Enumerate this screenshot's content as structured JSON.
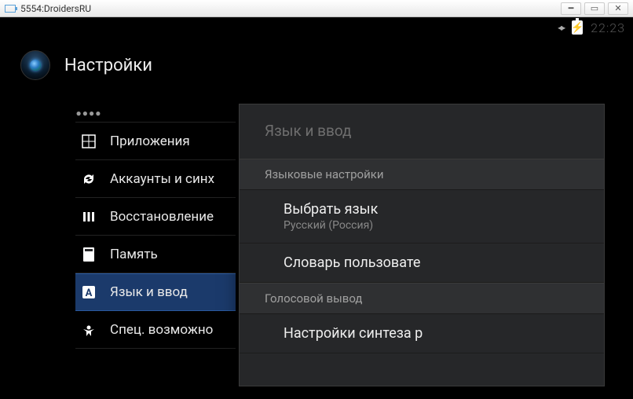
{
  "window": {
    "title": "5554:DroidersRU"
  },
  "status": {
    "time": "22:23"
  },
  "header": {
    "title": "Настройки"
  },
  "sidebar": {
    "items": [
      {
        "label": ""
      },
      {
        "label": "Приложения"
      },
      {
        "label": "Аккаунты и синх"
      },
      {
        "label": "Восстановление"
      },
      {
        "label": "Память"
      },
      {
        "label": "Язык и ввод"
      },
      {
        "label": "Спец. возможно"
      }
    ]
  },
  "panel": {
    "title": "Язык и ввод",
    "sections": [
      {
        "header": "Языковые настройки",
        "items": [
          {
            "title": "Выбрать язык",
            "sub": "Русский (Россия)"
          },
          {
            "title": "Словарь пользовате"
          }
        ]
      },
      {
        "header": "Голосовой вывод",
        "items": [
          {
            "title": "Настройки синтеза р"
          }
        ]
      }
    ]
  }
}
